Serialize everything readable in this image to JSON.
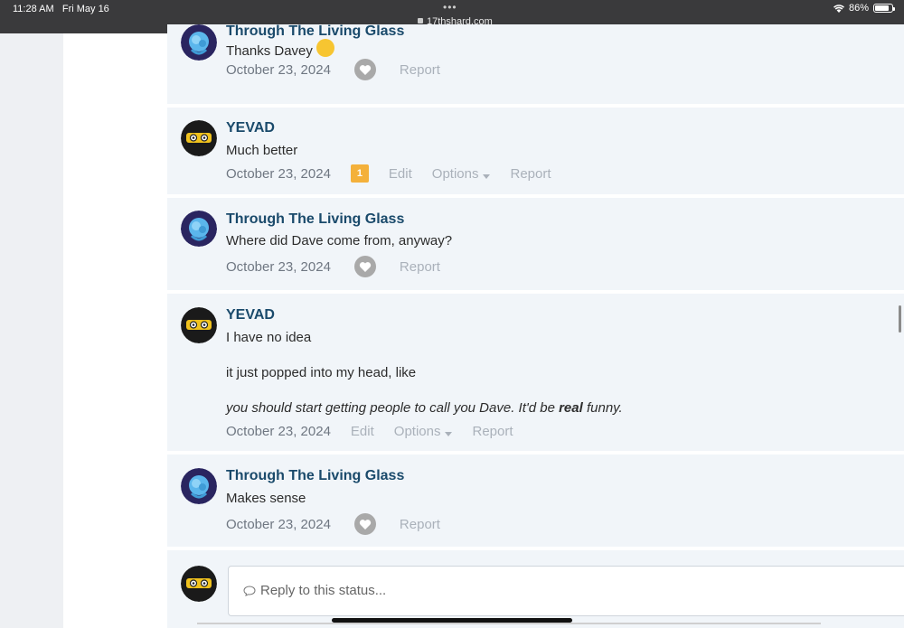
{
  "status_bar": {
    "time": "11:28 AM",
    "date": "Fri May 16",
    "url": "17thshard.com",
    "dots": "•••",
    "battery": "86%",
    "battery_level": 0.86
  },
  "comments": [
    {
      "author": "Through The Living Glass",
      "avatar": "rose-avatar",
      "lines": [
        {
          "text": "Thanks Davey",
          "italic": false,
          "emoji": "grinning-face"
        }
      ],
      "date": "October 23, 2024",
      "actions": [
        "Report"
      ],
      "like_icon": "heart-icon"
    },
    {
      "author": "YEVAD",
      "avatar": "ninja-avatar",
      "lines": [
        {
          "text": "Much better",
          "italic": false
        }
      ],
      "date": "October 23, 2024",
      "reaction_count": "1",
      "actions": [
        "Edit",
        "Options",
        "Report"
      ]
    },
    {
      "author": "Through The Living Glass",
      "avatar": "rose-avatar",
      "lines": [
        {
          "text": "Where did Dave come from, anyway?",
          "italic": false
        }
      ],
      "date": "October 23, 2024",
      "actions": [
        "Report"
      ],
      "like_icon": "heart-icon"
    },
    {
      "author": "YEVAD",
      "avatar": "ninja-avatar",
      "lines": [
        {
          "text": "I have no idea",
          "italic": false
        },
        {
          "text": "it just popped into my head, like",
          "italic": false
        },
        {
          "text_before": "you should start getting people to call you Dave. It'd be ",
          "bold": "real",
          "text_after": " funny.",
          "italic": true
        }
      ],
      "date": "October 23, 2024",
      "actions": [
        "Edit",
        "Options",
        "Report"
      ]
    },
    {
      "author": "Through The Living Glass",
      "avatar": "rose-avatar",
      "lines": [
        {
          "text": "Makes sense",
          "italic": false
        }
      ],
      "date": "October 23, 2024",
      "actions": [
        "Report"
      ],
      "like_icon": "heart-icon"
    }
  ],
  "reply": {
    "placeholder": "Reply to this status...",
    "icon": "speech-bubble-icon"
  },
  "colors": {
    "author": "#1a4a6b",
    "comment_bg": "#f1f5f9",
    "badge": "#f4b13b",
    "status_bar": "#3a3a3c"
  }
}
